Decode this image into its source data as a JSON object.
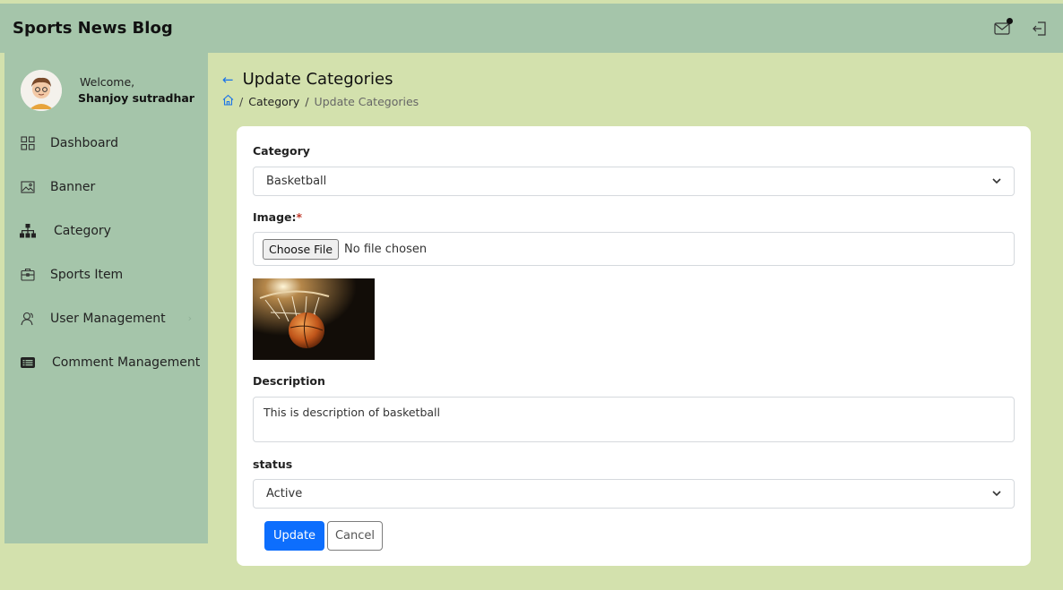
{
  "header": {
    "brand": "Sports News Blog",
    "icons": [
      "mail-icon",
      "logout-icon"
    ]
  },
  "sidebar": {
    "welcome": "Welcome,",
    "user_name": "Shanjoy sutradhar",
    "items": [
      {
        "label": "Dashboard",
        "icon": "dashboard-icon"
      },
      {
        "label": "Banner",
        "icon": "image-icon"
      },
      {
        "label": "Category",
        "icon": "sitemap-icon"
      },
      {
        "label": "Sports Item",
        "icon": "briefcase-icon"
      },
      {
        "label": "User Management",
        "icon": "users-icon",
        "has_chevron": true
      },
      {
        "label": "Comment Management",
        "icon": "list-icon"
      }
    ]
  },
  "page": {
    "title": "Update Categories",
    "breadcrumb": {
      "level1": "Category",
      "current": "Update Categories"
    }
  },
  "form": {
    "category_label": "Category",
    "category_value": "Basketball",
    "image_label": "Image:",
    "image_required": "*",
    "file_button": "Choose File",
    "file_status": "No file chosen",
    "description_label": "Description",
    "description_value": "This is description of basketball",
    "status_label": "status",
    "status_value": "Active",
    "update_button": "Update",
    "cancel_button": "Cancel"
  },
  "colors": {
    "page_bg": "#d3e1ad",
    "bar_bg": "#a5c5aa",
    "primary": "#0d6efd",
    "required": "#c0392b"
  }
}
